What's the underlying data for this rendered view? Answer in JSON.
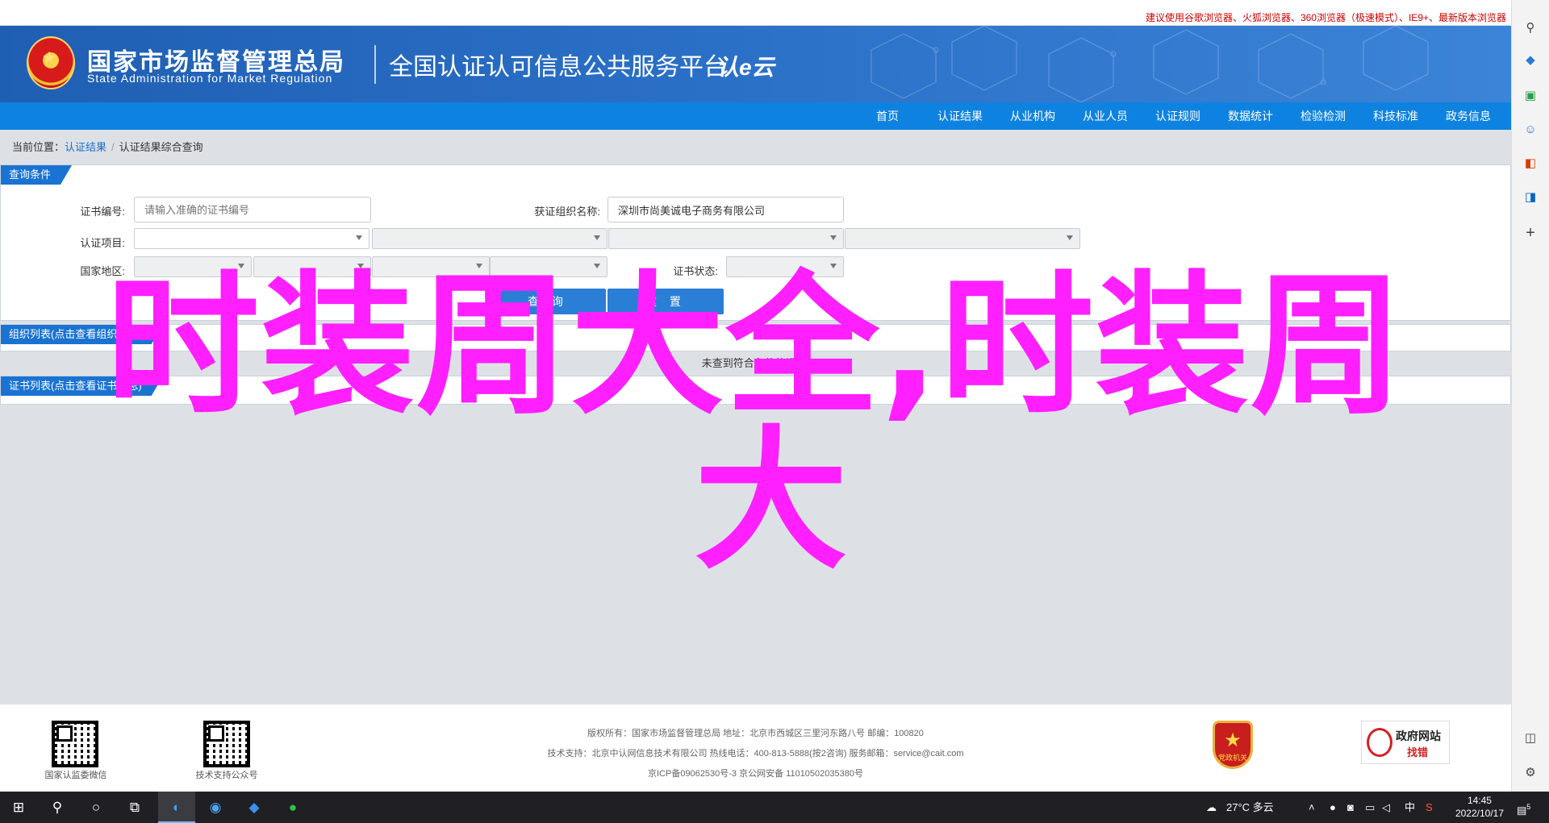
{
  "topstrip": {
    "warning": "建议使用谷歌浏览器、火狐浏览器、360浏览器（极速模式）、IE9+、最新版本浏览器"
  },
  "header": {
    "agency_cn": "国家市场监督管理总局",
    "agency_en": "State Administration  for  Market Regulation",
    "platform": "全国认证认可信息公共服务平台",
    "logo_text": "认e云"
  },
  "nav": {
    "items": [
      "首页",
      "认证结果",
      "从业机构",
      "从业人员",
      "认证规则",
      "数据统计",
      "检验检测",
      "科技标准",
      "政务信息"
    ]
  },
  "breadcrumb": {
    "prefix": "当前位置：",
    "link": "认证结果",
    "sep": "/",
    "current": "认证结果综合查询"
  },
  "query": {
    "tab": "查询条件",
    "cert_no_label": "证书编号:",
    "cert_no_placeholder": "请输入准确的证书编号",
    "org_name_label": "获证组织名称:",
    "org_name_value": "深圳市尚美诚电子商务有限公司",
    "project_label": "认证项目:",
    "region_label": "国家地区:",
    "status_label": "证书状态:",
    "search_btn": "查 询",
    "reset_btn": "重 置"
  },
  "org_panel": {
    "tab": "组织列表(点击查看组织信息)",
    "empty": "未查到符合条件的记录!"
  },
  "cert_panel": {
    "tab": "证书列表(点击查看证书信息)"
  },
  "overlay": {
    "line1": "时装周大全,时装周",
    "line2": "大"
  },
  "footer": {
    "qr1_caption": "国家认监委微信",
    "qr2_caption": "技术支持公众号",
    "line1": "版权所有：国家市场监督管理总局    地址：北京市西城区三里河东路八号    邮编：100820",
    "line2": "技术支持：北京中认网信息技术有限公司    热线电话：400-813-5888(按2咨询)    服务邮箱：service@cait.com",
    "line3": "京ICP备09062530号-3    京公网安备    11010502035380号",
    "party_badge": "党政机关",
    "gov_t1": "政府网站",
    "gov_t2": "找错"
  },
  "taskbar": {
    "weather": "27°C  多云",
    "ime": "中",
    "time": "14:45",
    "date": "2022/10/17",
    "notif_count": "5"
  }
}
